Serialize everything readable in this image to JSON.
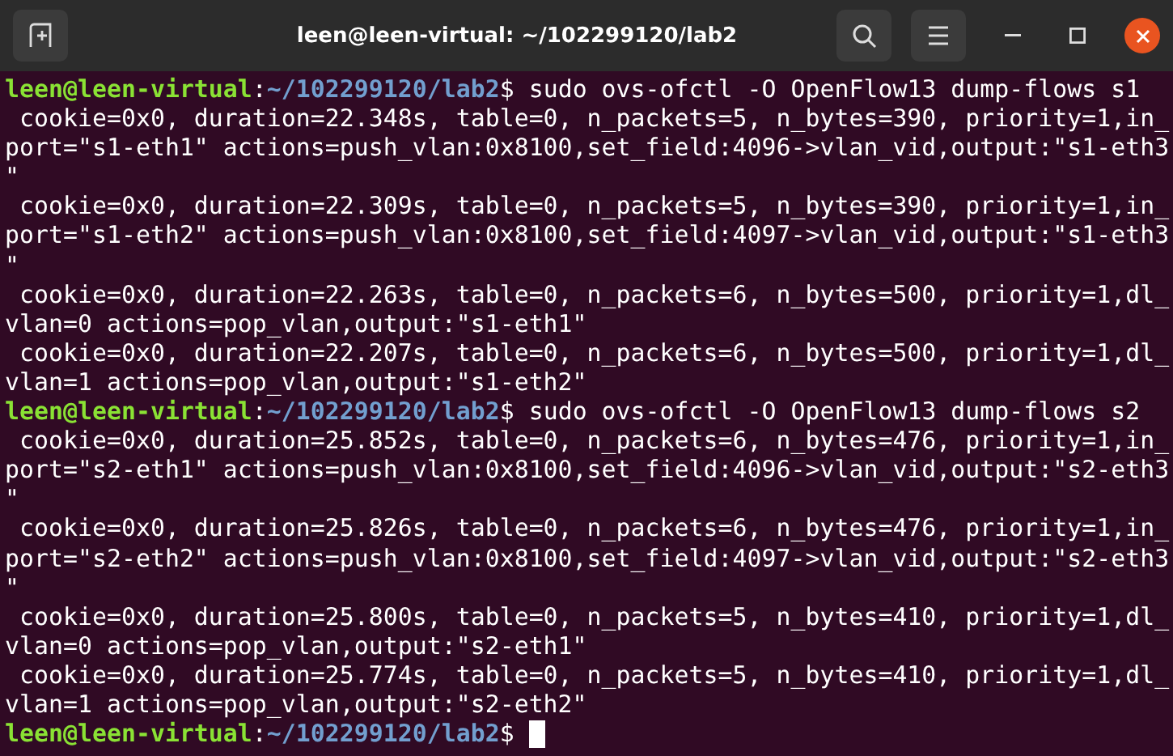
{
  "window": {
    "title": "leen@leen-virtual: ~/102299120/lab2"
  },
  "terminal": {
    "lines": [
      {
        "kind": "prompt",
        "user": "leen@leen-virtual",
        "separator": ":",
        "path": "~/102299120/lab2",
        "text": "$ sudo ovs-ofctl -O OpenFlow13 dump-flows s1",
        "cursor": false
      },
      {
        "kind": "output",
        "text": " cookie=0x0, duration=22.348s, table=0, n_packets=5, n_bytes=390, priority=1,in_"
      },
      {
        "kind": "output",
        "text": "port=\"s1-eth1\" actions=push_vlan:0x8100,set_field:4096->vlan_vid,output:\"s1-eth3"
      },
      {
        "kind": "output",
        "text": "\""
      },
      {
        "kind": "output",
        "text": " cookie=0x0, duration=22.309s, table=0, n_packets=5, n_bytes=390, priority=1,in_"
      },
      {
        "kind": "output",
        "text": "port=\"s1-eth2\" actions=push_vlan:0x8100,set_field:4097->vlan_vid,output:\"s1-eth3"
      },
      {
        "kind": "output",
        "text": "\""
      },
      {
        "kind": "output",
        "text": " cookie=0x0, duration=22.263s, table=0, n_packets=6, n_bytes=500, priority=1,dl_"
      },
      {
        "kind": "output",
        "text": "vlan=0 actions=pop_vlan,output:\"s1-eth1\""
      },
      {
        "kind": "output",
        "text": " cookie=0x0, duration=22.207s, table=0, n_packets=6, n_bytes=500, priority=1,dl_"
      },
      {
        "kind": "output",
        "text": "vlan=1 actions=pop_vlan,output:\"s1-eth2\""
      },
      {
        "kind": "prompt",
        "user": "leen@leen-virtual",
        "separator": ":",
        "path": "~/102299120/lab2",
        "text": "$ sudo ovs-ofctl -O OpenFlow13 dump-flows s2",
        "cursor": false
      },
      {
        "kind": "output",
        "text": " cookie=0x0, duration=25.852s, table=0, n_packets=6, n_bytes=476, priority=1,in_"
      },
      {
        "kind": "output",
        "text": "port=\"s2-eth1\" actions=push_vlan:0x8100,set_field:4096->vlan_vid,output:\"s2-eth3"
      },
      {
        "kind": "output",
        "text": "\""
      },
      {
        "kind": "output",
        "text": " cookie=0x0, duration=25.826s, table=0, n_packets=6, n_bytes=476, priority=1,in_"
      },
      {
        "kind": "output",
        "text": "port=\"s2-eth2\" actions=push_vlan:0x8100,set_field:4097->vlan_vid,output:\"s2-eth3"
      },
      {
        "kind": "output",
        "text": "\""
      },
      {
        "kind": "output",
        "text": " cookie=0x0, duration=25.800s, table=0, n_packets=5, n_bytes=410, priority=1,dl_"
      },
      {
        "kind": "output",
        "text": "vlan=0 actions=pop_vlan,output:\"s2-eth1\""
      },
      {
        "kind": "output",
        "text": " cookie=0x0, duration=25.774s, table=0, n_packets=5, n_bytes=410, priority=1,dl_"
      },
      {
        "kind": "output",
        "text": "vlan=1 actions=pop_vlan,output:\"s2-eth2\""
      },
      {
        "kind": "prompt",
        "user": "leen@leen-virtual",
        "separator": ":",
        "path": "~/102299120/lab2",
        "text": "$",
        "cursor": true
      }
    ]
  }
}
